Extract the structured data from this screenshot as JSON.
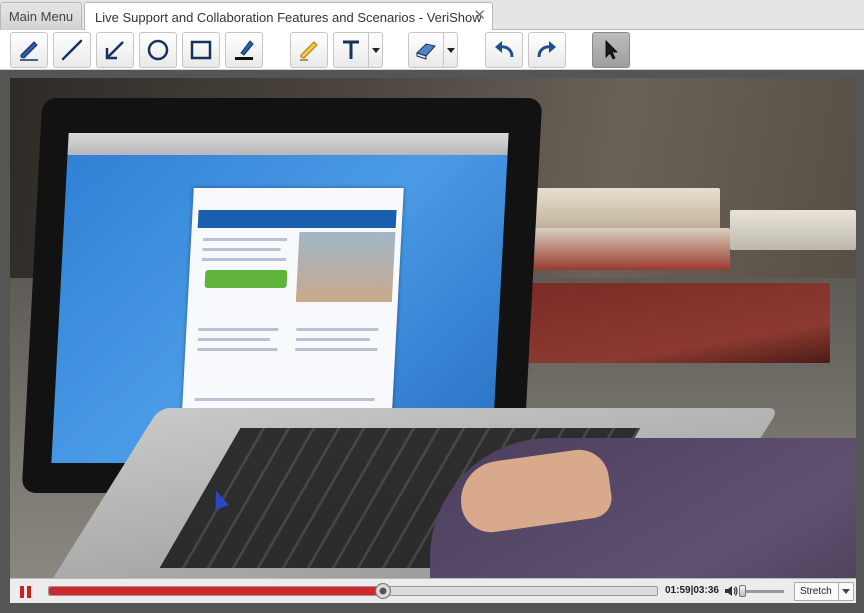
{
  "tabs": {
    "main_label": "Main Menu",
    "active_label": "Live Support and Collaboration Features and Scenarios - VeriShow",
    "close_glyph": "✕"
  },
  "toolbar": {
    "tools": [
      {
        "name": "pen-icon"
      },
      {
        "name": "line-icon"
      },
      {
        "name": "arrow-icon"
      },
      {
        "name": "ellipse-icon"
      },
      {
        "name": "rectangle-icon"
      },
      {
        "name": "marker-icon"
      },
      {
        "name": "highlighter-icon"
      },
      {
        "name": "text-icon"
      },
      {
        "name": "eraser-icon"
      },
      {
        "name": "undo-icon"
      },
      {
        "name": "redo-icon"
      },
      {
        "name": "pointer-icon",
        "selected": true
      }
    ],
    "accent": "#1f4f8f"
  },
  "player": {
    "elapsed": "01:59",
    "duration": "03:36",
    "time_display": "01:59|03:36",
    "progress_fraction": 0.55,
    "volume_fraction": 0.05,
    "scale_mode": "Stretch",
    "seek_color": "#d0262d",
    "pause_color": "#d21d1d"
  }
}
